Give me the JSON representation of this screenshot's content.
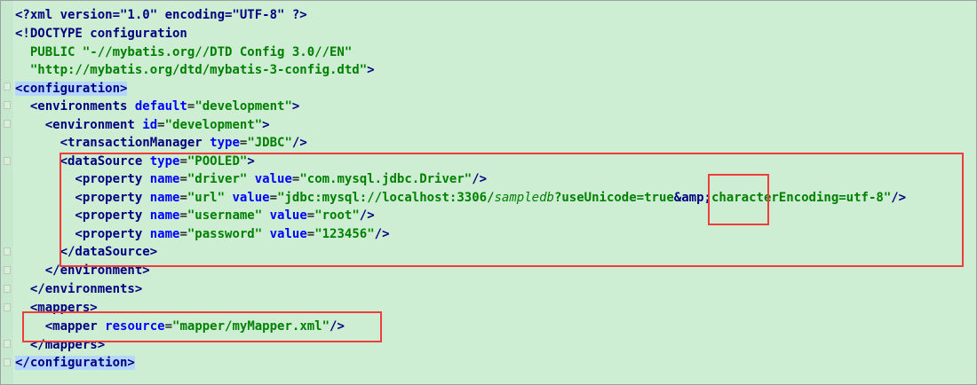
{
  "editor": {
    "lines": [
      {
        "parts": [
          {
            "text": "<?xml version=\"1.0\" encoding=\"UTF-8\" ?>",
            "kind": "prolog"
          }
        ]
      },
      {
        "parts": [
          {
            "text": "<!DOCTYPE configuration",
            "kind": "prolog"
          }
        ]
      },
      {
        "parts": [
          {
            "text": "  PUBLIC \"-//mybatis.org//DTD Config 3.0//EN\"",
            "kind": "value"
          }
        ]
      },
      {
        "parts": [
          {
            "text": "  \"http://mybatis.org/dtd/mybatis-3-config.dtd\"",
            "kind": "value"
          },
          {
            "text": ">",
            "kind": "prolog"
          }
        ]
      },
      {
        "parts": [
          {
            "text": "<configuration>",
            "kind": "tag",
            "highlight": true
          }
        ]
      },
      {
        "parts": [
          {
            "text": "  <environments ",
            "kind": "tag"
          },
          {
            "text": "default",
            "kind": "attr"
          },
          {
            "text": "=",
            "kind": "punct"
          },
          {
            "text": "\"development\"",
            "kind": "value"
          },
          {
            "text": ">",
            "kind": "tag"
          }
        ]
      },
      {
        "parts": [
          {
            "text": "    <environment ",
            "kind": "tag"
          },
          {
            "text": "id",
            "kind": "attr"
          },
          {
            "text": "=",
            "kind": "punct"
          },
          {
            "text": "\"development\"",
            "kind": "value"
          },
          {
            "text": ">",
            "kind": "tag"
          }
        ]
      },
      {
        "parts": [
          {
            "text": "      <transactionManager ",
            "kind": "tag"
          },
          {
            "text": "type",
            "kind": "attr"
          },
          {
            "text": "=",
            "kind": "punct"
          },
          {
            "text": "\"JDBC\"",
            "kind": "value"
          },
          {
            "text": "/>",
            "kind": "tag"
          }
        ]
      },
      {
        "parts": [
          {
            "text": "      <dataSource ",
            "kind": "tag"
          },
          {
            "text": "type",
            "kind": "attr"
          },
          {
            "text": "=",
            "kind": "punct"
          },
          {
            "text": "\"POOLED\"",
            "kind": "value"
          },
          {
            "text": ">",
            "kind": "tag"
          }
        ]
      },
      {
        "parts": [
          {
            "text": "        <property ",
            "kind": "tag"
          },
          {
            "text": "name",
            "kind": "attr"
          },
          {
            "text": "=",
            "kind": "punct"
          },
          {
            "text": "\"driver\"",
            "kind": "value"
          },
          {
            "text": " ",
            "kind": "punct"
          },
          {
            "text": "value",
            "kind": "attr"
          },
          {
            "text": "=",
            "kind": "punct"
          },
          {
            "text": "\"com.mysql.jdbc.Driver\"",
            "kind": "value"
          },
          {
            "text": "/>",
            "kind": "tag"
          }
        ]
      },
      {
        "parts": [
          {
            "text": "        <property ",
            "kind": "tag"
          },
          {
            "text": "name",
            "kind": "attr"
          },
          {
            "text": "=",
            "kind": "punct"
          },
          {
            "text": "\"url\"",
            "kind": "value"
          },
          {
            "text": " ",
            "kind": "punct"
          },
          {
            "text": "value",
            "kind": "attr"
          },
          {
            "text": "=",
            "kind": "punct"
          },
          {
            "text": "\"jdbc:mysql://localhost:3306/",
            "kind": "value"
          },
          {
            "text": "sampledb",
            "kind": "italic"
          },
          {
            "text": "?useUnicode=true",
            "kind": "value"
          },
          {
            "text": "&amp;",
            "kind": "entity"
          },
          {
            "text": "characterEncoding=utf-8\"",
            "kind": "value"
          },
          {
            "text": "/>",
            "kind": "tag"
          }
        ]
      },
      {
        "parts": [
          {
            "text": "        <property ",
            "kind": "tag"
          },
          {
            "text": "name",
            "kind": "attr"
          },
          {
            "text": "=",
            "kind": "punct"
          },
          {
            "text": "\"username\"",
            "kind": "value"
          },
          {
            "text": " ",
            "kind": "punct"
          },
          {
            "text": "value",
            "kind": "attr"
          },
          {
            "text": "=",
            "kind": "punct"
          },
          {
            "text": "\"root\"",
            "kind": "value"
          },
          {
            "text": "/>",
            "kind": "tag"
          }
        ]
      },
      {
        "parts": [
          {
            "text": "        <property ",
            "kind": "tag"
          },
          {
            "text": "name",
            "kind": "attr"
          },
          {
            "text": "=",
            "kind": "punct"
          },
          {
            "text": "\"password\"",
            "kind": "value"
          },
          {
            "text": " ",
            "kind": "punct"
          },
          {
            "text": "value",
            "kind": "attr"
          },
          {
            "text": "=",
            "kind": "punct"
          },
          {
            "text": "\"123456\"",
            "kind": "value"
          },
          {
            "text": "/>",
            "kind": "tag"
          }
        ]
      },
      {
        "parts": [
          {
            "text": "      </dataSource>",
            "kind": "tag"
          }
        ]
      },
      {
        "parts": [
          {
            "text": "    </environment>",
            "kind": "tag"
          }
        ]
      },
      {
        "parts": [
          {
            "text": "  </environments>",
            "kind": "tag"
          }
        ]
      },
      {
        "parts": [
          {
            "text": "  <mappers>",
            "kind": "tag"
          }
        ]
      },
      {
        "parts": [
          {
            "text": "    <mapper ",
            "kind": "tag"
          },
          {
            "text": "resource",
            "kind": "attr"
          },
          {
            "text": "=",
            "kind": "punct"
          },
          {
            "text": "\"mapper/myMapper.xml\"",
            "kind": "value"
          },
          {
            "text": "/>",
            "kind": "tag"
          }
        ]
      },
      {
        "parts": [
          {
            "text": "  </mappers>",
            "kind": "tag"
          }
        ]
      },
      {
        "parts": [
          {
            "text": "</configuration>",
            "kind": "tag",
            "highlight": true
          }
        ]
      }
    ]
  },
  "colors": {
    "background": "#cdeed3",
    "annotation_red": "#ef3d3d",
    "tag": "#000080",
    "attribute": "#0000ff",
    "value": "#008000",
    "highlight": "#b5d7ff"
  }
}
